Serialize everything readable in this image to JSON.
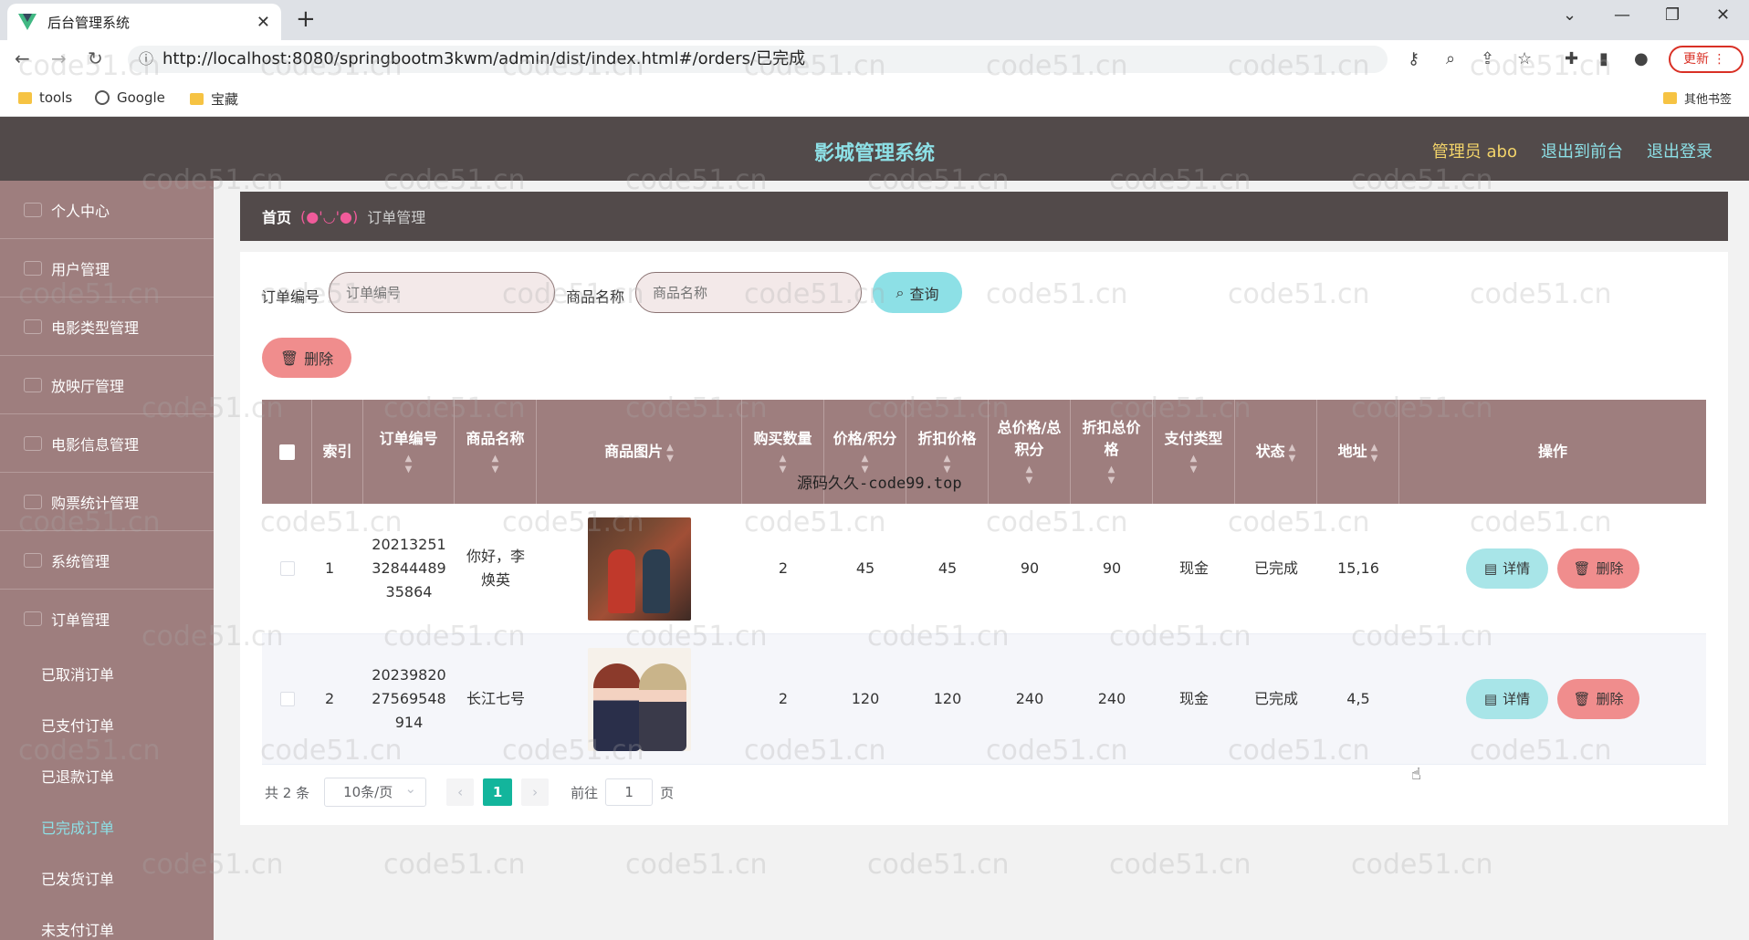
{
  "browser": {
    "tab_title": "后台管理系统",
    "tab_close": "✕",
    "new_tab": "+",
    "url": "http://localhost:8080/springbootm3kwm/admin/dist/index.html#/orders/已完成",
    "update_label": "更新",
    "bookmarks": [
      "tools",
      "Google",
      "宝藏"
    ],
    "other_bookmarks": "其他书签"
  },
  "header": {
    "title": "影城管理系统",
    "admin": "管理员 abo",
    "to_front": "退出到前台",
    "logout": "退出登录"
  },
  "sidebar": {
    "items": [
      "个人中心",
      "用户管理",
      "电影类型管理",
      "放映厅管理",
      "电影信息管理",
      "购票统计管理",
      "系统管理",
      "订单管理"
    ],
    "sub_items": [
      "已取消订单",
      "已支付订单",
      "已退款订单",
      "已完成订单",
      "已发货订单",
      "未支付订单"
    ],
    "active_sub": "已完成订单"
  },
  "breadcrumb": {
    "home": "首页",
    "separator": "(●'◡'●)",
    "current": "订单管理"
  },
  "search": {
    "order_label": "订单编号",
    "order_placeholder": "订单编号",
    "goods_label": "商品名称",
    "goods_placeholder": "商品名称",
    "query_label": "查询"
  },
  "toolbar": {
    "delete_label": "删除"
  },
  "table": {
    "headers": {
      "index": "索引",
      "order_no": "订单编号",
      "goods_name": "商品名称",
      "goods_image": "商品图片",
      "qty": "购买数量",
      "price": "价格/积分",
      "discount_price": "折扣价格",
      "total": "总价格/总积分",
      "discount_total": "折扣总价格",
      "pay_type": "支付类型",
      "status": "状态",
      "address": "地址",
      "actions": "操作"
    },
    "rows": [
      {
        "index": "1",
        "order_no": "2021325132844489 35864",
        "order_no_lines": [
          "20213251",
          "32844489",
          "35864"
        ],
        "goods_name_lines": [
          "你好，李",
          "焕英"
        ],
        "qty": "2",
        "price": "45",
        "discount_price": "45",
        "total": "90",
        "discount_total": "90",
        "pay_type": "现金",
        "status": "已完成",
        "address": "15,16"
      },
      {
        "index": "2",
        "order_no_lines": [
          "20239820",
          "27569548",
          "914"
        ],
        "goods_name_lines": [
          "长江七号",
          ""
        ],
        "qty": "2",
        "price": "120",
        "discount_price": "120",
        "total": "240",
        "discount_total": "240",
        "pay_type": "现金",
        "status": "已完成",
        "address": "4,5"
      }
    ],
    "detail_label": "详情",
    "delete_label": "删除"
  },
  "pagination": {
    "total": "共 2 条",
    "page_size": "10条/页",
    "current_page": "1",
    "goto_prefix": "前往",
    "goto_value": "1",
    "goto_suffix": "页"
  },
  "watermark": {
    "text": "code51.cn",
    "center": "源码久久-code99.top"
  },
  "colors": {
    "header_bg": "#524a4a",
    "sidebar_bg": "#9e7e7e",
    "accent_cyan": "#8de0e6",
    "danger_pink": "#f08d8d",
    "page_active": "#13b59c"
  }
}
